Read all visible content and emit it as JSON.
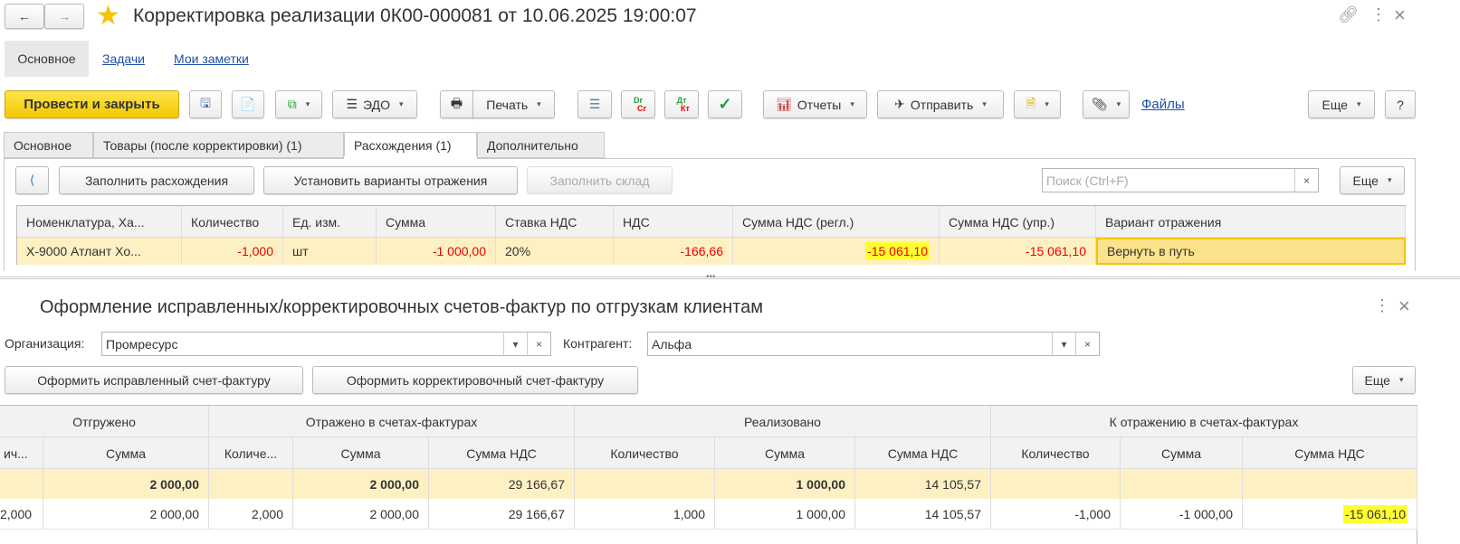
{
  "window": {
    "title": "Корректировка реализации 0К00-000081 от 10.06.2025 19:00:07"
  },
  "nav": {
    "tabs": [
      "Основное",
      "Задачи",
      "Мои заметки"
    ]
  },
  "toolbar": {
    "post_close": "Провести и закрыть",
    "edo": "ЭДО",
    "print": "Печать",
    "reports": "Отчеты",
    "send": "Отправить",
    "files": "Файлы",
    "more": "Еще",
    "help": "?",
    "dr": "Dr",
    "cr": "Cr",
    "dt": "Дт",
    "kt": "Кт"
  },
  "tabs": [
    "Основное",
    "Товары (после корректировки) (1)",
    "Расхождения (1)",
    "Дополнительно"
  ],
  "diff": {
    "fill": "Заполнить расхождения",
    "set_variants": "Установить варианты отражения",
    "fill_wh": "Заполнить склад",
    "search_placeholder": "Поиск (Ctrl+F)",
    "more": "Еще",
    "columns": [
      "Номенклатура, Ха...",
      "Количество",
      "Ед. изм.",
      "Сумма",
      "Ставка НДС",
      "НДС",
      "Сумма НДС (регл.)",
      "Сумма НДС (упр.)",
      "Вариант отражения"
    ],
    "row": [
      "Х-9000 Атлант Хо...",
      "-1,000",
      "шт",
      "-1 000,00",
      "20%",
      "-166,66",
      "-15 061,10",
      "-15 061,10",
      "Вернуть в путь"
    ]
  },
  "lower": {
    "title": "Оформление исправленных/корректировочных счетов-фактур по отгрузкам клиентам",
    "org_label": "Организация:",
    "org_value": "Промресурс",
    "contr_label": "Контрагент:",
    "contr_value": "Альфа",
    "btn_fixed": "Оформить исправленный счет-фактуру",
    "btn_corr": "Оформить корректировочный счет-фактуру",
    "more": "Еще",
    "groups": [
      "Отгружено",
      "Отражено в счетах-фактурах",
      "Реализовано",
      "К отражению в счетах-фактурах"
    ],
    "columns": [
      "ич...",
      "Сумма",
      "Количе...",
      "Сумма",
      "Сумма НДС",
      "Количество",
      "Сумма",
      "Сумма НДС",
      "Количество",
      "Сумма",
      "Сумма НДС"
    ],
    "total": [
      "",
      "2 000,00",
      "",
      "2 000,00",
      "29 166,67",
      "",
      "1 000,00",
      "14 105,57",
      "",
      "",
      ""
    ],
    "row": [
      "2,000",
      "2 000,00",
      "2,000",
      "2 000,00",
      "29 166,67",
      "1,000",
      "1 000,00",
      "14 105,57",
      "-1,000",
      "-1 000,00",
      "-15 061,10"
    ]
  }
}
